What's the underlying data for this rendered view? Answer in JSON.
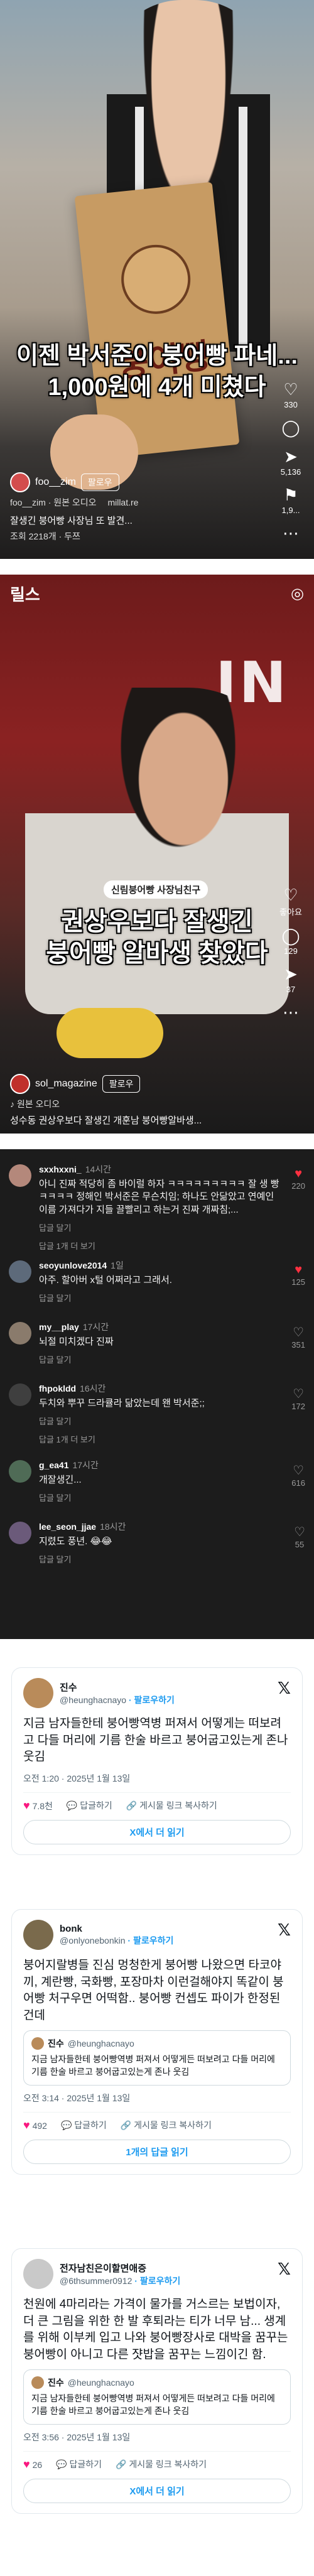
{
  "reel1": {
    "caption_line1": "이젠 박서준이 붕어빵 파네...",
    "caption_line2": "1,000원에 4개 미쳤다",
    "bag_brand": "붕어빵",
    "account": "foo__zim",
    "follow": "팔로우",
    "audio": "foo__zim · 원본 오디오",
    "audio2": "millat.re",
    "subtitle": "잘생긴 붕어빵 사장님 또 발견...",
    "views": "조회 2218개 · 두쯔",
    "likes": "330",
    "comments": "",
    "shares": "5,136",
    "saves": "1,9..."
  },
  "reel2": {
    "title": "릴스",
    "sign_text": "IN",
    "pill": "신림붕어빵 사장님친구",
    "caption_line1": "권상우보다 잘생긴",
    "caption_line2": "붕어빵 알바생 찾았다",
    "account": "sol_magazine",
    "follow": "팔로우",
    "audio": "♪ 원본 오디오",
    "subtitle": "성수동 권상우보다 잘생긴 개훈남 붕어빵알바생...",
    "likes": "좋아요",
    "comments_count": "129",
    "shares_count": "37"
  },
  "comments": [
    {
      "user": "sxxhxxni_",
      "ago": "14시간",
      "text": "아니 진짜 적당히 좀 바이럴 하자 ㅋㅋㅋㅋㅋㅋㅋㅋㅋ 잘 생 빵 ㅋㅋㅋㅋ 정해인 박서준은 무슨치임; 하나도 안닮았고 연예인 이름 가져다가 지들 끌빨리고 하는거 진짜 개짜침;...",
      "reply": "답글 달기",
      "more": "답글 1개 더 보기",
      "likes": "220",
      "red": true
    },
    {
      "user": "seoyunlove2014",
      "ago": "1일",
      "text": "아주. 할아버 x털 어쩌라고 그래서.",
      "reply": "답글 달기",
      "more": "",
      "likes": "125",
      "red": true
    },
    {
      "user": "my__play",
      "ago": "17시간",
      "text": "뇌절 미치겠다 진짜",
      "reply": "답글 달기",
      "more": "",
      "likes": "351",
      "red": false
    },
    {
      "user": "fhpokldd",
      "ago": "16시간",
      "text": "두치와 뿌꾸 드라큘라 닮았는데 왠 박서준;;",
      "reply": "답글 달기",
      "more": "답글 1개 더 보기",
      "likes": "172",
      "red": false
    },
    {
      "user": "g_ea41",
      "ago": "17시간",
      "text": "개잘생긴...",
      "reply": "답글 달기",
      "more": "",
      "likes": "616",
      "red": false
    },
    {
      "user": "lee_seon_jjae",
      "ago": "18시간",
      "text": "지렸도 풍년. 😂😂",
      "reply": "답글 달기",
      "more": "",
      "likes": "55",
      "red": false
    }
  ],
  "tweet1": {
    "name": "진수",
    "handle": "@heunghacnayo",
    "follow": "· 팔로우하기",
    "body": "지금 남자들한테 붕어빵역병 퍼져서 어떻게는 떠보려고 다들 머리에 기름 한술 바르고 붕어굽고있는게 존나 웃김",
    "time": "오전 1:20 · 2025년 1월 13일",
    "likes": "7.8천",
    "reply": "답글하기",
    "copy": "게시물 링크 복사하기",
    "button": "X에서 더 읽기"
  },
  "tweet2": {
    "name": "bonk",
    "handle": "@onlyonebonkin",
    "follow": "· 팔로우하기",
    "body": "붕어지랄병들 진심 멍청한게 붕어빵 나왔으면 타코야끼, 계란빵, 국화빵, 포장마차 이런걸해야지 똑같이 붕어빵 처구우면 어떡함.. 붕어빵 컨셉도 파이가 한정된건데",
    "quote_name": "진수",
    "quote_handle": "@heunghacnayo",
    "quote_text": "지금 남자들한테 붕어빵역병 퍼져서 어떻게든 떠보려고 다들 머리에 기름 한술 바르고 붕어굽고있는게 존나 웃김",
    "time": "오전 3:14 · 2025년 1월 13일",
    "likes": "492",
    "reply": "답글하기",
    "copy": "게시물 링크 복사하기",
    "button": "1개의 답글 읽기"
  },
  "tweet3": {
    "name": "전자남친은이할면애증",
    "handle": "@6thsummer0912",
    "follow": "· 팔로우하기",
    "body": "천원에 4마리라는 가격이 물가를 거스르는 보법이자, 더 큰 그림을 위한 한 발 후퇴라는 티가 너무 남... 생계를 위해 이부케 입고 나와 붕어빵장사로 대박을 꿈꾸는 붕어빵이 아니고 다른 쟛밥을 꿈꾸는 느낌이긴 함.",
    "quote_name": "진수",
    "quote_handle": "@heunghacnayo",
    "quote_text": "지금 남자들한테 붕어빵역병 퍼져서 어떻게든 떠보려고 다들 머리에 기름 한술 바르고 붕어굽고있는게 존나 웃김",
    "time": "오전 3:56 · 2025년 1월 13일",
    "likes": "26",
    "reply": "답글하기",
    "copy": "게시물 링크 복사하기",
    "button": "X에서 더 읽기"
  }
}
